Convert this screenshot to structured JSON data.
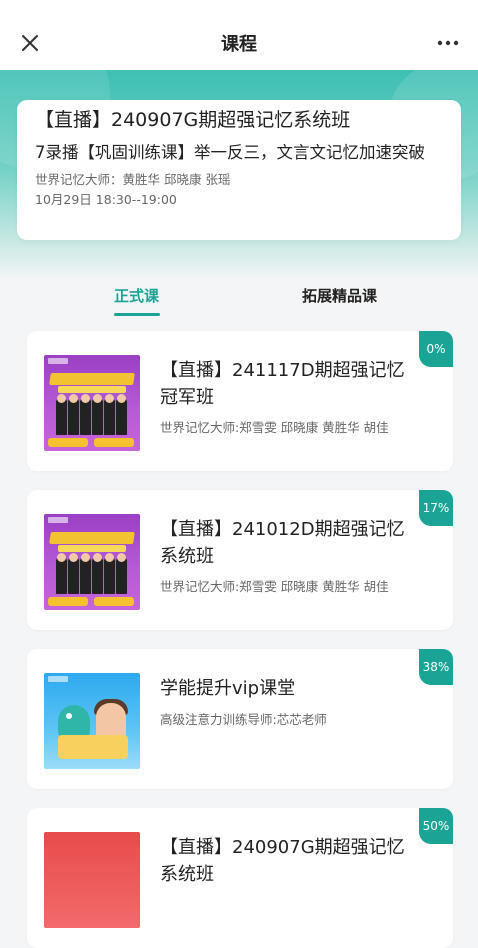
{
  "header": {
    "title": "课程",
    "close_icon": "close-icon",
    "more_icon": "more-icon"
  },
  "live": {
    "title": "【直播】240907G期超强记忆系统班",
    "subtitle": "7录播【巩固训练课】举一反三，文言文记忆加速突破",
    "teachers": "世界记忆大师：黄胜华 邱晓康 张瑶",
    "time": "10月29日 18:30--19:00"
  },
  "tabs": [
    {
      "label": "正式课",
      "active": true
    },
    {
      "label": "拓展精品课",
      "active": false
    }
  ],
  "courses": [
    {
      "title": "【直播】241117D期超强记忆冠军班",
      "teachers": "世界记忆大师:郑雪雯 邱晓康 黄胜华 胡佳",
      "progress": "0%",
      "thumb_color": "#9b3fc4"
    },
    {
      "title": "【直播】241012D期超强记忆系统班",
      "teachers": "世界记忆大师:郑雪雯 邱晓康 黄胜华 胡佳",
      "progress": "17%",
      "thumb_color": "#9b3fc4"
    },
    {
      "title": "学能提升vip课堂",
      "teachers": "高级注意力训练导师:芯芯老师",
      "progress": "38%",
      "thumb_color": "#2da9ef"
    },
    {
      "title": "【直播】240907G期超强记忆系统班",
      "teachers": "",
      "progress": "50%",
      "thumb_color": "#e84b4b"
    }
  ],
  "colors": {
    "accent": "#1aa495",
    "hero": "#3dbfb2",
    "background": "#f4f5f7"
  }
}
